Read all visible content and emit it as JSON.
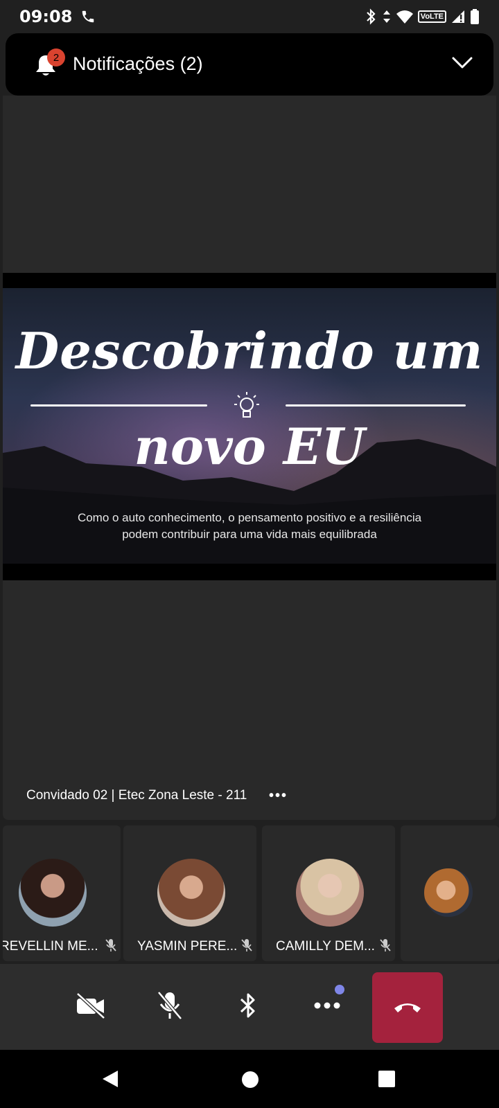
{
  "status_bar": {
    "time": "09:08",
    "network_label": "VoLTE"
  },
  "notification": {
    "badge_count": "2",
    "title": "Notificações (2)"
  },
  "slide": {
    "title_line1": "Descobrindo um",
    "title_line2": "novo EU",
    "subtitle_line1": "Como o auto conhecimento, o pensamento positivo e a resiliência",
    "subtitle_line2": "podem contribuir para uma vida mais equilibrada"
  },
  "presenter": {
    "name": "Convidado 02 | Etec Zona Leste - 211",
    "more_label": "•••"
  },
  "participants": [
    {
      "name": "REVELLIN ME...",
      "muted": true
    },
    {
      "name": "YASMIN PERE...",
      "muted": true
    },
    {
      "name": "CAMILLY DEM...",
      "muted": true
    },
    {
      "name": "",
      "muted": false
    }
  ],
  "controls": {
    "items": [
      "camera-off",
      "mic-off",
      "bluetooth",
      "more-options",
      "hang-up"
    ],
    "hangup_color": "#a4223d",
    "more_indicator_color": "#7f86e8"
  },
  "colors": {
    "background": "#202020",
    "tile": "#292929",
    "notification_badge": "#d9432f"
  }
}
